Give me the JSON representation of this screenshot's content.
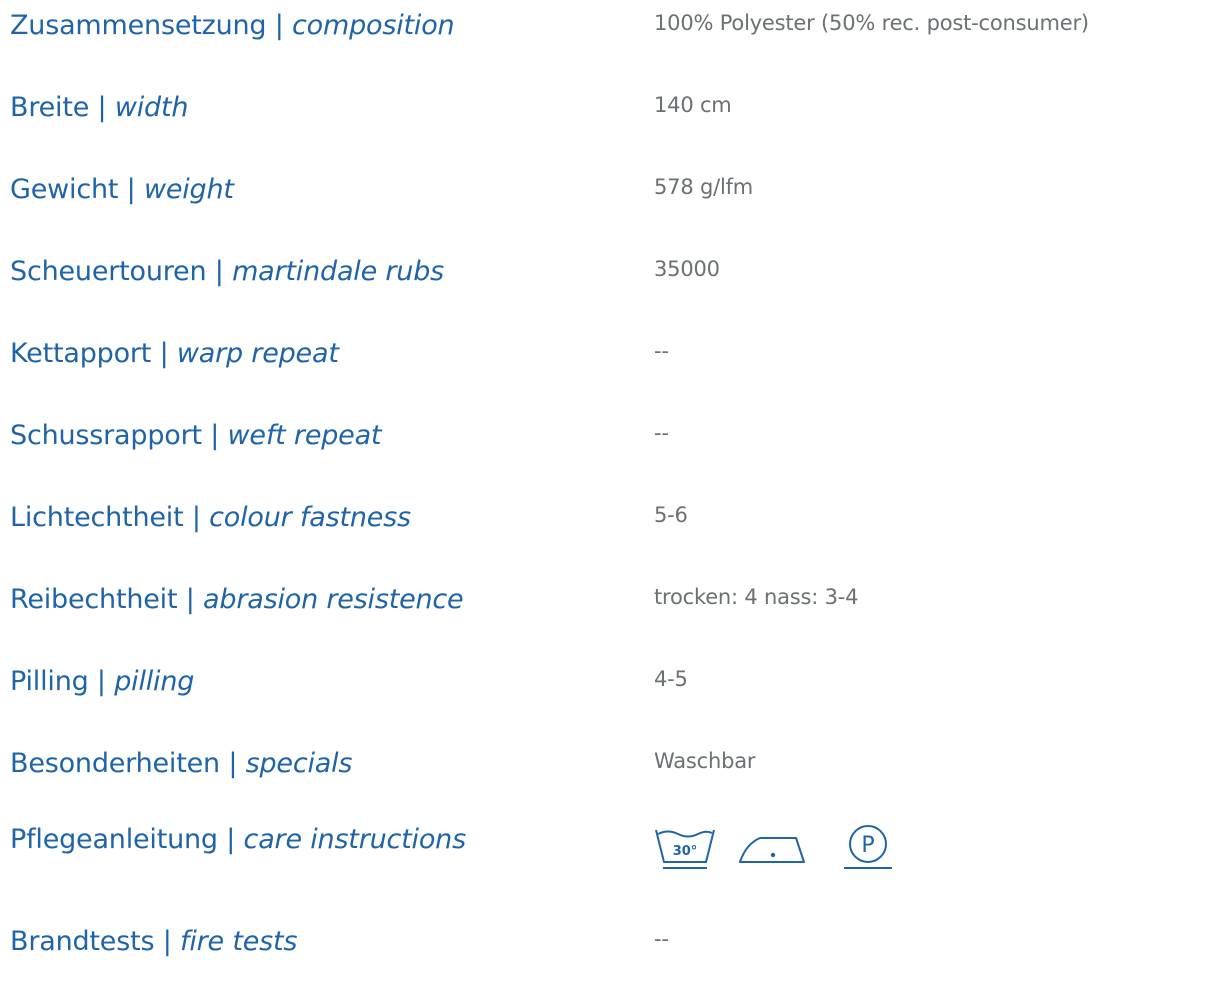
{
  "colors": {
    "label": "#1f64a8",
    "value": "#6b7073",
    "icon": "#1f64a8"
  },
  "specs": [
    {
      "label_de": "Zusammensetzung",
      "label_en": "composition",
      "value": "100% Polyester (50% rec. post-consumer)"
    },
    {
      "label_de": "Breite",
      "label_en": "width",
      "value": "140 cm"
    },
    {
      "label_de": "Gewicht",
      "label_en": "weight",
      "value": "578 g/lfm"
    },
    {
      "label_de": "Scheuertouren",
      "label_en": "martindale rubs",
      "value": "35000"
    },
    {
      "label_de": "Kettapport",
      "label_en": "warp repeat",
      "value": "--"
    },
    {
      "label_de": "Schussrapport",
      "label_en": "weft repeat",
      "value": "--"
    },
    {
      "label_de": "Lichtechtheit",
      "label_en": "colour fastness",
      "value": "5-6"
    },
    {
      "label_de": "Reibechtheit",
      "label_en": "abrasion resistence",
      "value": "trocken: 4 nass: 3-4"
    },
    {
      "label_de": "Pilling",
      "label_en": "pilling",
      "value": "4-5"
    },
    {
      "label_de": "Besonderheiten",
      "label_en": "specials",
      "value": "Waschbar"
    }
  ],
  "care": {
    "label_de": "Pflegeanleitung",
    "label_en": "care instructions",
    "icons": [
      {
        "name": "wash-30-icon",
        "text": "30°"
      },
      {
        "name": "iron-low-icon"
      },
      {
        "name": "dryclean-p-icon",
        "text": "P"
      }
    ]
  },
  "fire": {
    "label_de": "Brandtests",
    "label_en": "fire tests",
    "value": "--"
  },
  "separator": " | "
}
